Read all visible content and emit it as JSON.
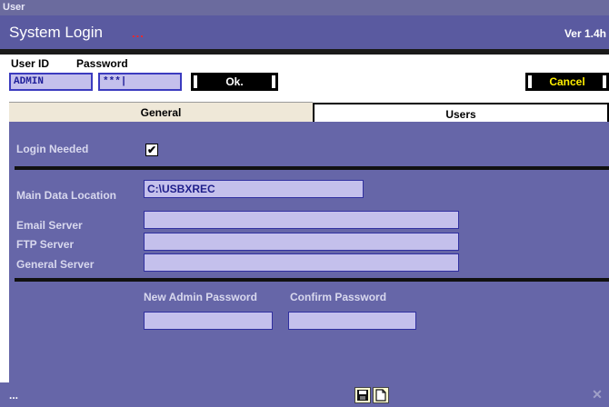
{
  "window": {
    "title": "User"
  },
  "header": {
    "app_title": "System Login",
    "dots": "...",
    "version": "Ver 1.4h"
  },
  "login": {
    "user_id_label": "User ID",
    "password_label": "Password",
    "user_id_value": "ADMIN",
    "password_value": "***|",
    "ok_label": "Ok.",
    "cancel_label": "Cancel"
  },
  "tabs": [
    {
      "label": "General",
      "active": true
    },
    {
      "label": "Users",
      "active": false
    }
  ],
  "general": {
    "login_needed_label": "Login Needed",
    "login_needed_checked": "✔",
    "main_data_location_label": "Main Data Location",
    "main_data_location_value": "C:\\USBXREC",
    "email_server_label": "Email Server",
    "email_server_value": "",
    "ftp_server_label": "FTP Server",
    "ftp_server_value": "",
    "general_server_label": "General Server",
    "general_server_value": "",
    "new_admin_password_label": "New Admin Password",
    "confirm_password_label": "Confirm Password",
    "new_admin_password_value": "",
    "confirm_password_value": ""
  },
  "statusbar": {
    "text": "...",
    "close_glyph": "✕"
  },
  "icons": {
    "save": "save-icon",
    "new": "new-document-icon",
    "close": "close-icon"
  },
  "colors": {
    "panel": "#6666a8",
    "header": "#5a5aa0",
    "field": "#c4c0ec",
    "accent_red": "#ff2222",
    "cancel_text": "#ffee00"
  }
}
